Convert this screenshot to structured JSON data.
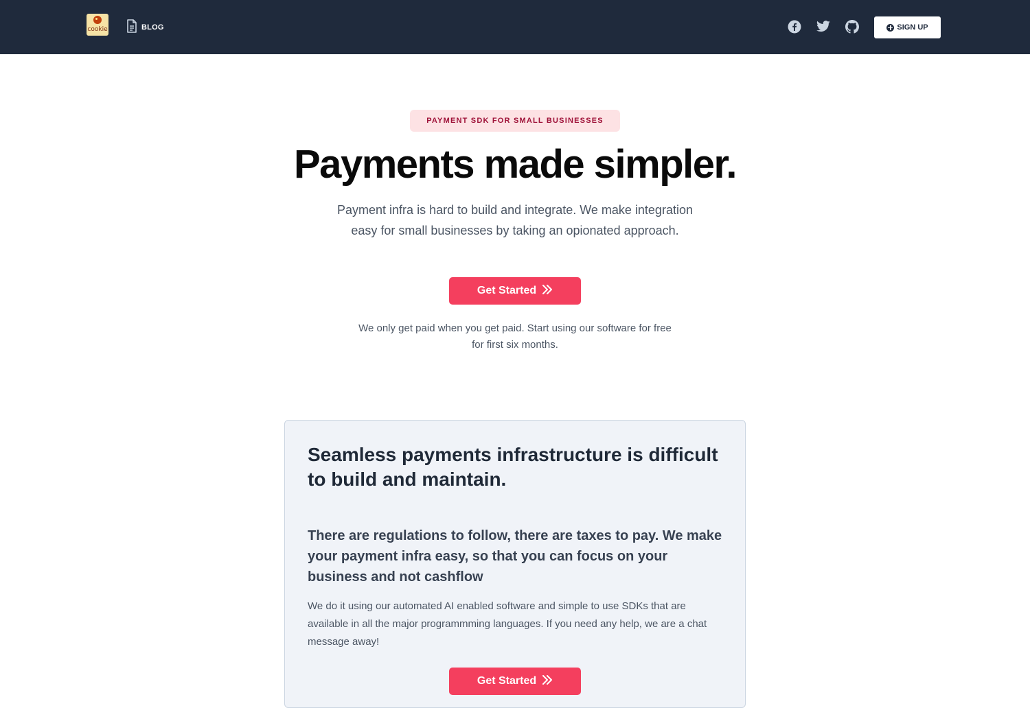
{
  "header": {
    "logo_text": "cookie",
    "blog_label": "BLOG",
    "social_icons": [
      "facebook-icon",
      "twitter-icon",
      "github-icon"
    ],
    "signup_label": "SIGN UP"
  },
  "hero": {
    "badge": "PAYMENT SDK FOR SMALL BUSINESSES",
    "title": "Payments made simpler.",
    "subtitle": "Payment infra is hard to build and integrate. We make integration easy for small businesses by taking an opionated approach.",
    "cta_label": "Get Started",
    "note": "We only get paid when you get paid. Start using our software for free for first six months."
  },
  "card": {
    "title": "Seamless payments infrastructure is difficult to build and maintain.",
    "lead": "There are regulations to follow, there are taxes to pay. We make your payment infra easy, so that you can focus on your business and not cashflow",
    "body": "We do it using our automated AI enabled software and simple to use SDKs that are available in all the major programmming languages. If you need any help, we are a chat message away!",
    "cta_label": "Get Started"
  },
  "colors": {
    "header_bg": "#1f2a3c",
    "accent": "#f43f5e",
    "badge_bg": "#fde2e4",
    "badge_text": "#9f1239",
    "card_bg": "#f0f3f8"
  }
}
